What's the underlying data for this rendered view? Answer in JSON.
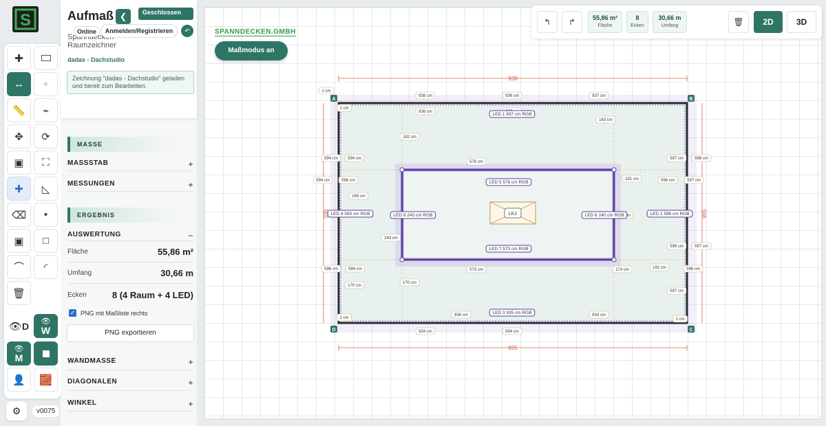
{
  "app": {
    "title": "Aufmaß",
    "status_select": "Geschlossen",
    "online_badge": "Online",
    "login_button": "Anmelden/Registrieren",
    "subtitle": "Spanndecken Raumzeichner",
    "project_name": "dadas - Dachstudio",
    "message": "Zeichnung \"dadas - Dachstudio\" geladen und bereit zum Bearbeiten.",
    "version": "v0075",
    "accent_color": "#2f7566"
  },
  "panel": {
    "section_masse": "MASSE",
    "massstab": "MASSSTAB",
    "messungen": "MESSUNGEN",
    "section_ergebnis": "ERGEBNIS",
    "auswertung": "AUSWERTUNG",
    "flaeche_label": "Fläche",
    "flaeche_value": "55,86 m²",
    "umfang_label": "Umfang",
    "umfang_value": "30,66 m",
    "ecken_label": "Ecken",
    "ecken_value": "8 (4 Raum + 4 LED)",
    "png_checkbox": "PNG mit Maßliste rechts",
    "export_button": "PNG exportieren",
    "wandmasse": "WANDMASSE",
    "diagonalen": "DIAGONALEN",
    "winkel": "WINKEL"
  },
  "tools": {
    "d_label": "D",
    "w_label": "W",
    "m_label": "M"
  },
  "toolbar": {
    "area_value": "55,86 m²",
    "area_label": "Fläche",
    "corners_value": "8",
    "corners_label": "Ecken",
    "perimeter_value": "30,66 m",
    "perimeter_label": "Umfang",
    "mode_2d": "2D",
    "mode_3d": "3D"
  },
  "canvas": {
    "brand": "SPANNDECKEN.GMBH",
    "measure_button": "Maßmodus an",
    "corners": [
      "A",
      "B",
      "C",
      "D"
    ],
    "dim_top": "938",
    "dim_bottom": "935",
    "dim_left": "565",
    "dim_right": "598",
    "lamp_label": "LK1",
    "outer_labels": {
      "top": [
        "938 cm",
        "936 cm",
        "937 cm"
      ],
      "top_inner": [
        "936 cm",
        "937 cm"
      ],
      "bottom": [
        "934 cm",
        "934 cm"
      ],
      "bottom_inner": [
        "936 cm",
        "934 cm"
      ],
      "left": [
        "594 cm",
        "594 cm",
        "594 cm",
        "596 cm",
        "596 cm",
        "594 cm"
      ],
      "right": [
        "597 cm",
        "598 cm",
        "596 cm",
        "597 cm",
        "598 cm",
        "597 cm",
        "596 cm",
        "597 cm"
      ],
      "corner_small": [
        "1 cm",
        "1 cm",
        "1 cm",
        "1 cm"
      ],
      "diag": [
        "182 cm",
        "163 cm",
        "169 cm",
        "191 cm",
        "243 cm",
        "174 cm",
        "192 cm",
        "170 cm",
        "170 cm"
      ]
    },
    "led_labels": {
      "led1": "LED 1 937 cm RGB",
      "led2": "LED 2 596 cm RGB",
      "led3": "LED 3 935 cm RGB",
      "led4": "LED 4 593 cm RGB",
      "led5": "LED 5 576 cm RGB",
      "led6": "LED 6 240 cm RGB",
      "led7": "LED 7 573 cm RGB",
      "led8": "LED 8 243 cm RGB"
    },
    "inner_labels": [
      "576 cm",
      "573 cm",
      "cm"
    ]
  }
}
